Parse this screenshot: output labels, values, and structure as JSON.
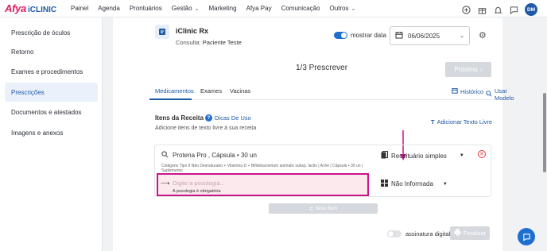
{
  "brand": {
    "name": "Afya",
    "product": "iCLINIC"
  },
  "nav": [
    {
      "label": "Painel",
      "dropdown": false
    },
    {
      "label": "Agenda",
      "dropdown": false
    },
    {
      "label": "Prontuários",
      "dropdown": false
    },
    {
      "label": "Gestão",
      "dropdown": true
    },
    {
      "label": "Marketing",
      "dropdown": false
    },
    {
      "label": "Afya Pay",
      "dropdown": false
    },
    {
      "label": "Comunicação",
      "dropdown": false
    },
    {
      "label": "Outros",
      "dropdown": true
    }
  ],
  "user": {
    "initials": "DM"
  },
  "sidebar": {
    "items": [
      {
        "label": "Prescrição de óculos",
        "active": false
      },
      {
        "label": "Retorno",
        "active": false
      },
      {
        "label": "Exames e procedimentos",
        "active": false
      },
      {
        "label": "Prescrições",
        "active": true
      },
      {
        "label": "Documentos e atestados",
        "active": false
      },
      {
        "label": "Imagens e anexos",
        "active": false
      }
    ]
  },
  "header": {
    "title": "iClinic Rx",
    "consult_label": "Consulta:",
    "patient": "Paciente Teste",
    "show_date_label": "mostrar data",
    "show_date_on": true,
    "date": "06/06/2025"
  },
  "stepper": {
    "text": "1/3 Prescrever",
    "next_label": "Próximo"
  },
  "tabs": {
    "items": [
      "Medicamentos",
      "Exames",
      "Vacinas"
    ],
    "active": 0,
    "history_label": "Histórico",
    "use_model_label": "Usar Modelo"
  },
  "items_section": {
    "title": "Itens da Receita",
    "tips_label": "Dicas De Uso",
    "hint": "Adicione itens de texto livre à sua receita",
    "add_free_text_label": "Adicionar Texto Livre"
  },
  "medication": {
    "name": "Protena Pro  , Cápsula • 30 un",
    "description": "Colágeno Tipo II Não Desnaturado + Vitamina D + Bifidobacterium animalis subsp. lactis | Aché | Cápsula • 30 un | Suplemento",
    "recipe_type": "Receituário simples",
    "posology_placeholder": "Digite a posologia...",
    "posology_error": "A posologia é obrigatória",
    "route": "Não Informada"
  },
  "actions": {
    "new_item_label": "Novo Item",
    "signature_label": "assinatura digital",
    "finalize_label": "Finalizar"
  },
  "colors": {
    "brand_pink": "#d91e63",
    "primary_blue": "#1f5aa6",
    "annotation_magenta": "#c8168d"
  }
}
